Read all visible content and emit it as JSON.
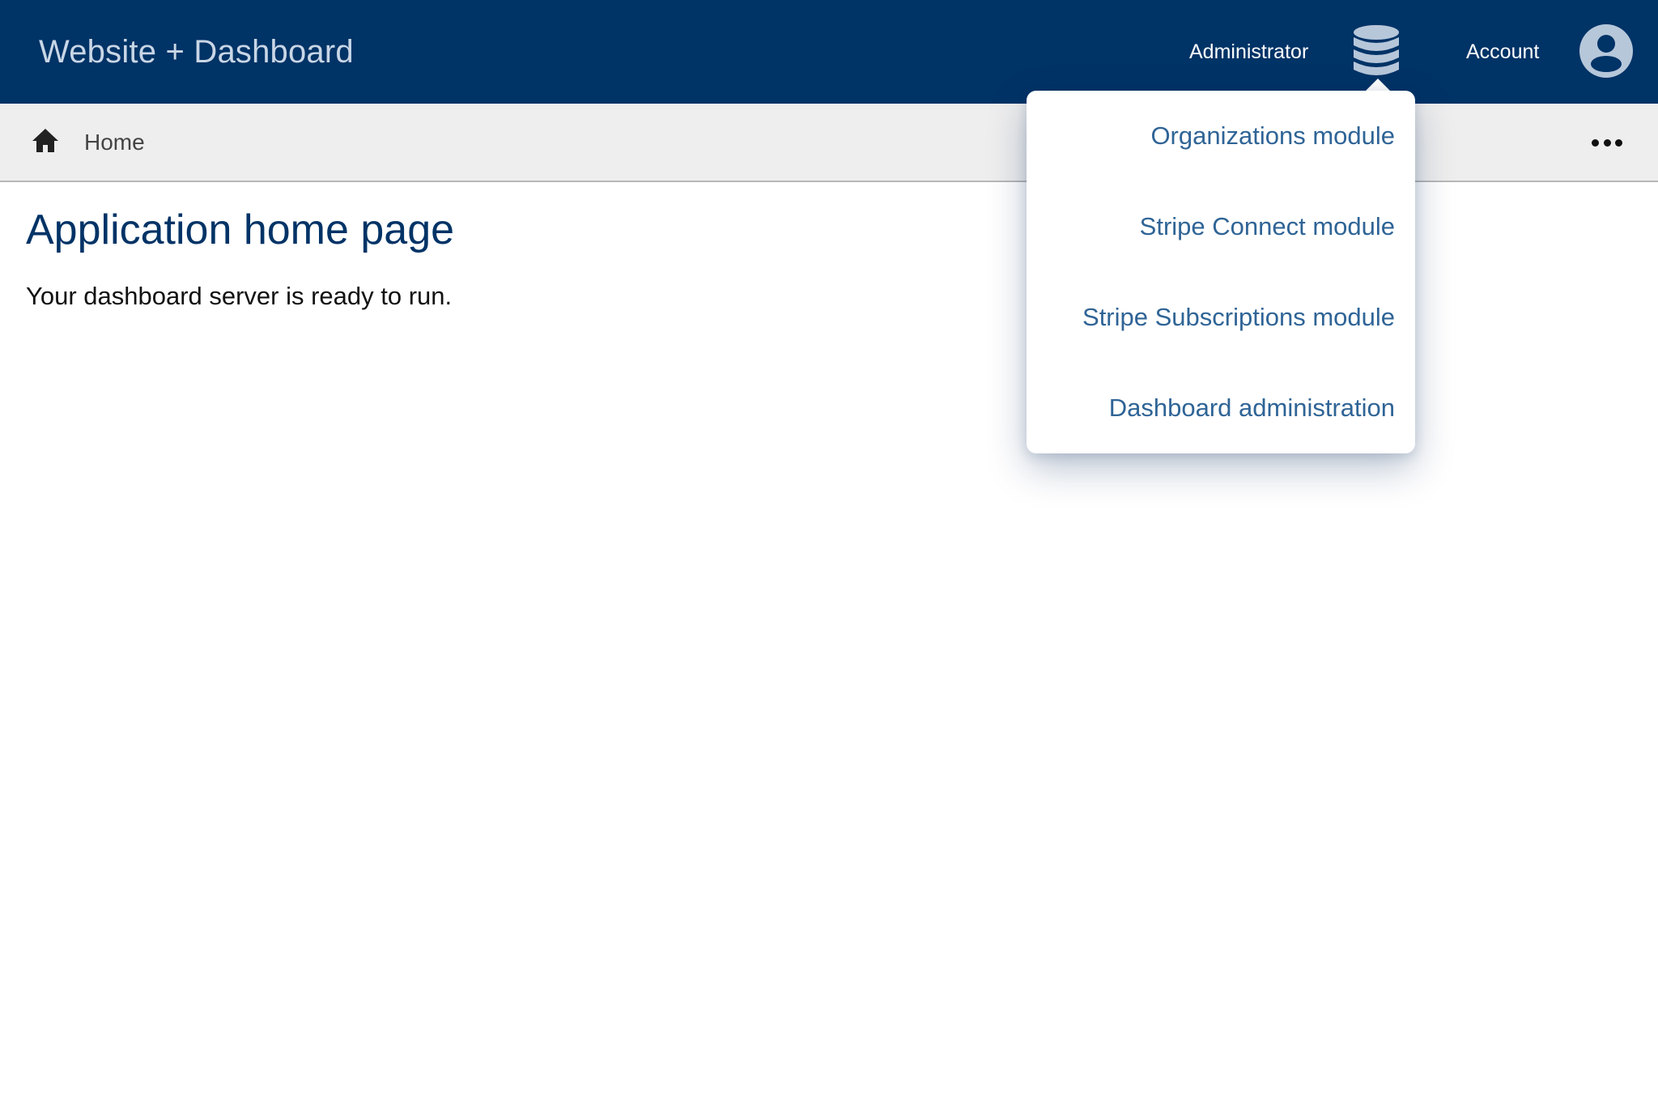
{
  "header": {
    "brand": "Website + Dashboard",
    "admin_label": "Administrator",
    "account_label": "Account",
    "admin_icon": "database-icon",
    "account_icon": "user-circle-icon"
  },
  "breadcrumb": {
    "home_icon": "home-icon",
    "label": "Home",
    "more_icon": "more-horizontal-icon"
  },
  "main": {
    "title": "Application home page",
    "text": "Your dashboard server is ready to run."
  },
  "admin_menu": {
    "items": [
      {
        "label": "Organizations module"
      },
      {
        "label": "Stripe Connect module"
      },
      {
        "label": "Stripe Subscriptions module"
      },
      {
        "label": "Dashboard administration"
      }
    ]
  },
  "colors": {
    "header_bg": "#003366",
    "brand_text": "#c9d6e6",
    "icon_fill": "#b7c7da",
    "crumb_bg": "#eeeeee",
    "title": "#003366",
    "menu_link": "#2f6496"
  }
}
